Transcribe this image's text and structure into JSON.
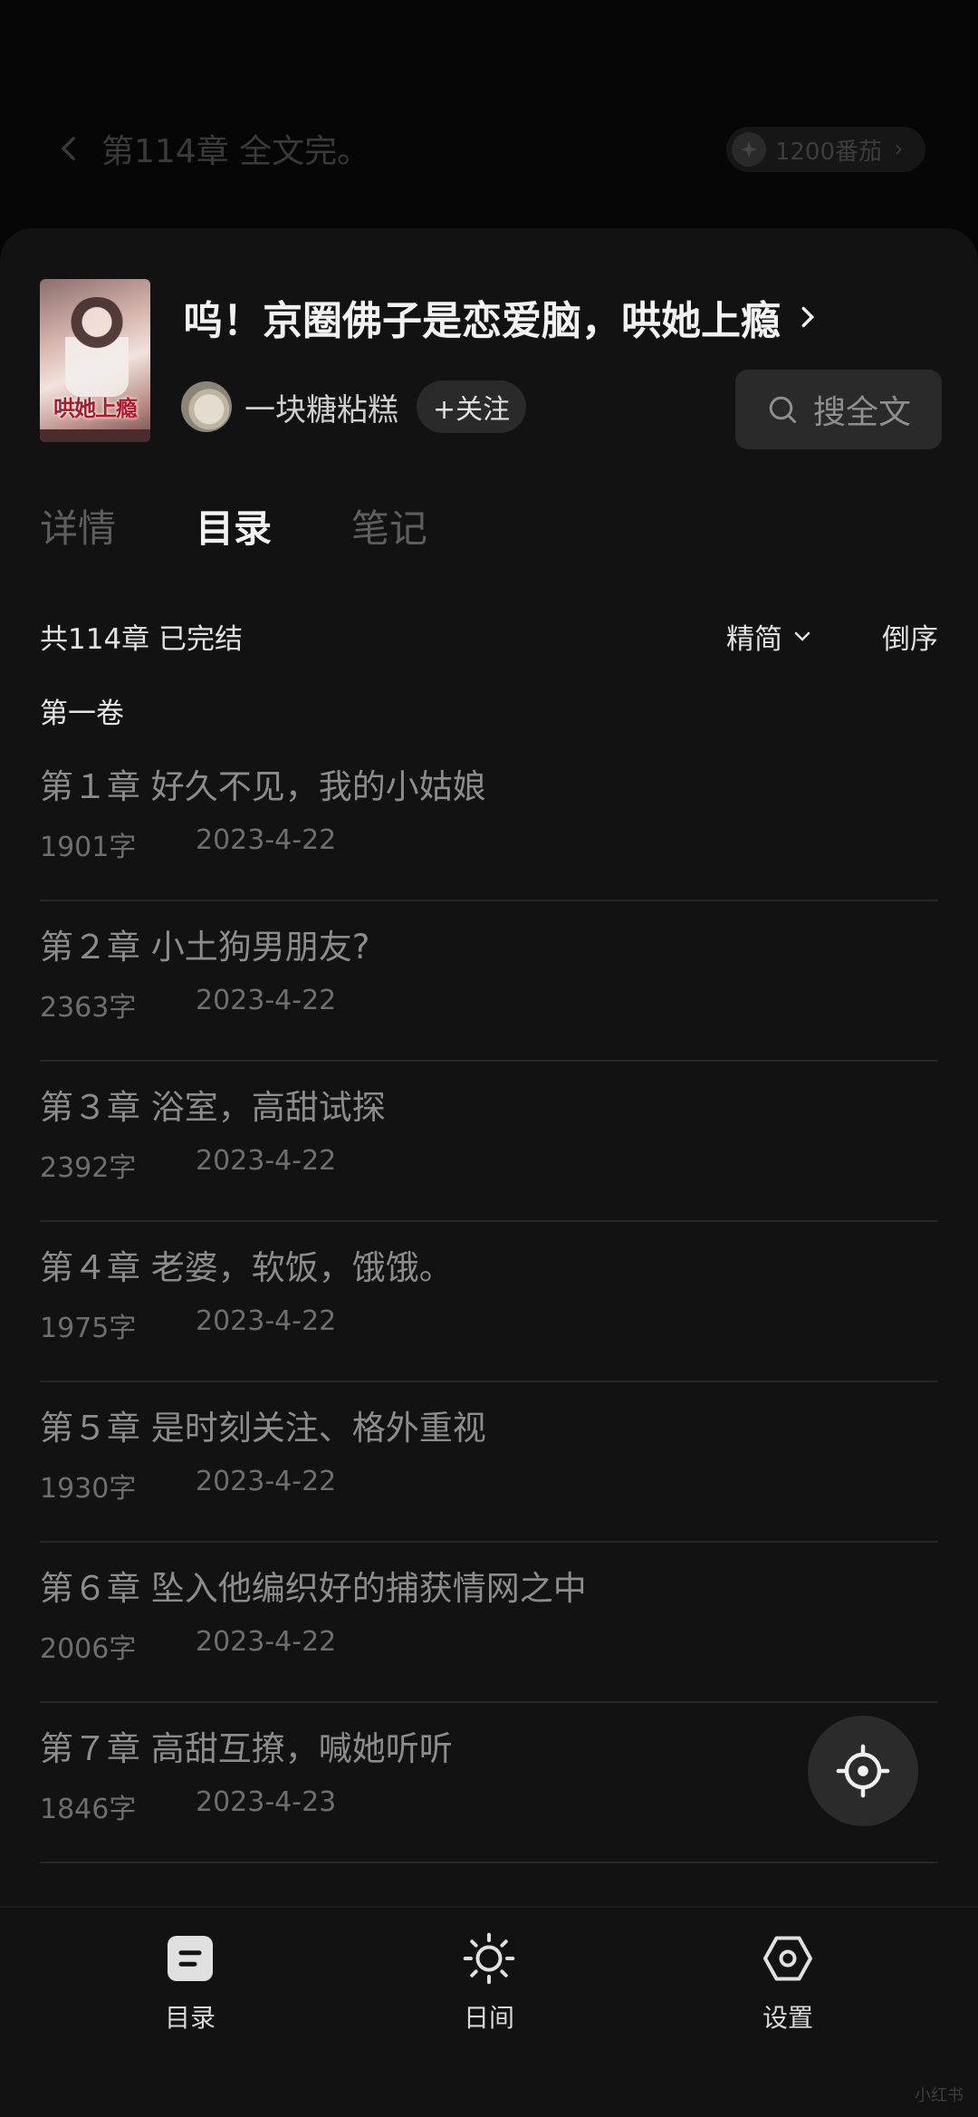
{
  "reader": {
    "chapter_heading": "第114章 全文完。",
    "coins": "1200番茄"
  },
  "book": {
    "title": "呜！京圈佛子是恋爱脑，哄她上瘾",
    "cover_text": "哄她上瘾",
    "author": "一块糖粘糕",
    "follow_label": "+关注",
    "search_label": "搜全文"
  },
  "tabs": [
    {
      "label": "详情",
      "active": false
    },
    {
      "label": "目录",
      "active": true
    },
    {
      "label": "笔记",
      "active": false
    }
  ],
  "toc": {
    "summary": "共114章 已完结",
    "variant": "精简",
    "sort": "倒序",
    "volume": "第一卷",
    "chapters": [
      {
        "title": "第１章 好久不见，我的小姑娘",
        "words": "1901字",
        "date": "2023-4-22"
      },
      {
        "title": "第２章 小土狗男朋友?",
        "words": "2363字",
        "date": "2023-4-22"
      },
      {
        "title": "第３章 浴室，高甜试探",
        "words": "2392字",
        "date": "2023-4-22"
      },
      {
        "title": "第４章 老婆，软饭，饿饿。",
        "words": "1975字",
        "date": "2023-4-22"
      },
      {
        "title": "第５章 是时刻关注、格外重视",
        "words": "1930字",
        "date": "2023-4-22"
      },
      {
        "title": "第６章 坠入他编织好的捕获情网之中",
        "words": "2006字",
        "date": "2023-4-22"
      },
      {
        "title": "第７章 高甜互撩，喊她听听",
        "words": "1846字",
        "date": "2023-4-23"
      }
    ]
  },
  "bottom_nav": [
    {
      "label": "目录",
      "icon": "toc-icon"
    },
    {
      "label": "日间",
      "icon": "sun-icon"
    },
    {
      "label": "设置",
      "icon": "settings-icon"
    }
  ],
  "watermark": "小红书"
}
